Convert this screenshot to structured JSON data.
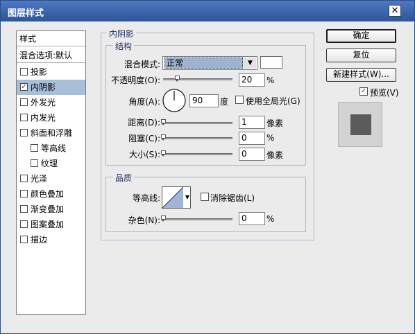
{
  "window": {
    "title": "图层样式",
    "close_glyph": "✕"
  },
  "style_list": {
    "header": "样式",
    "blend_options": "混合选项:默认",
    "items": [
      {
        "label": "投影",
        "checked": false
      },
      {
        "label": "内阴影",
        "checked": true,
        "selected": true
      },
      {
        "label": "外发光",
        "checked": false
      },
      {
        "label": "内发光",
        "checked": false
      },
      {
        "label": "斜面和浮雕",
        "checked": false
      },
      {
        "label": "等高线",
        "checked": false
      },
      {
        "label": "纹理",
        "checked": false
      },
      {
        "label": "光泽",
        "checked": false
      },
      {
        "label": "颜色叠加",
        "checked": false
      },
      {
        "label": "渐变叠加",
        "checked": false
      },
      {
        "label": "图案叠加",
        "checked": false
      },
      {
        "label": "描边",
        "checked": false
      }
    ]
  },
  "panel": {
    "title": "内阴影",
    "structure": {
      "legend": "结构",
      "blend_mode": {
        "label": "混合模式:",
        "value": "正常"
      },
      "opacity": {
        "label": "不透明度(O):",
        "value": "20",
        "unit": "%",
        "level": 0.2
      },
      "angle": {
        "label": "角度(A):",
        "value": "90",
        "unit": "度",
        "use_global_label": "使用全局光(G)",
        "use_global": false
      },
      "distance": {
        "label": "距离(D):",
        "value": "1",
        "unit": "像素",
        "level": 0.0
      },
      "choke": {
        "label": "阻塞(C):",
        "value": "0",
        "unit": "%",
        "level": 0.0
      },
      "size": {
        "label": "大小(S):",
        "value": "0",
        "unit": "像素",
        "level": 0.0
      }
    },
    "quality": {
      "legend": "品质",
      "contour": {
        "label": "等高线:",
        "antialias_label": "消除锯齿(L)",
        "antialias": false
      },
      "noise": {
        "label": "杂色(N):",
        "value": "0",
        "unit": "%",
        "level": 0.0
      }
    }
  },
  "buttons": {
    "ok": "确定",
    "reset": "复位",
    "new_style": "新建样式(W)...",
    "preview_label": "预览(V)",
    "preview_checked": true
  },
  "colors": {
    "titlebar": "#3a64ab",
    "selection": "#a7bfd9",
    "preview_swatch": "#5b5b5b"
  }
}
